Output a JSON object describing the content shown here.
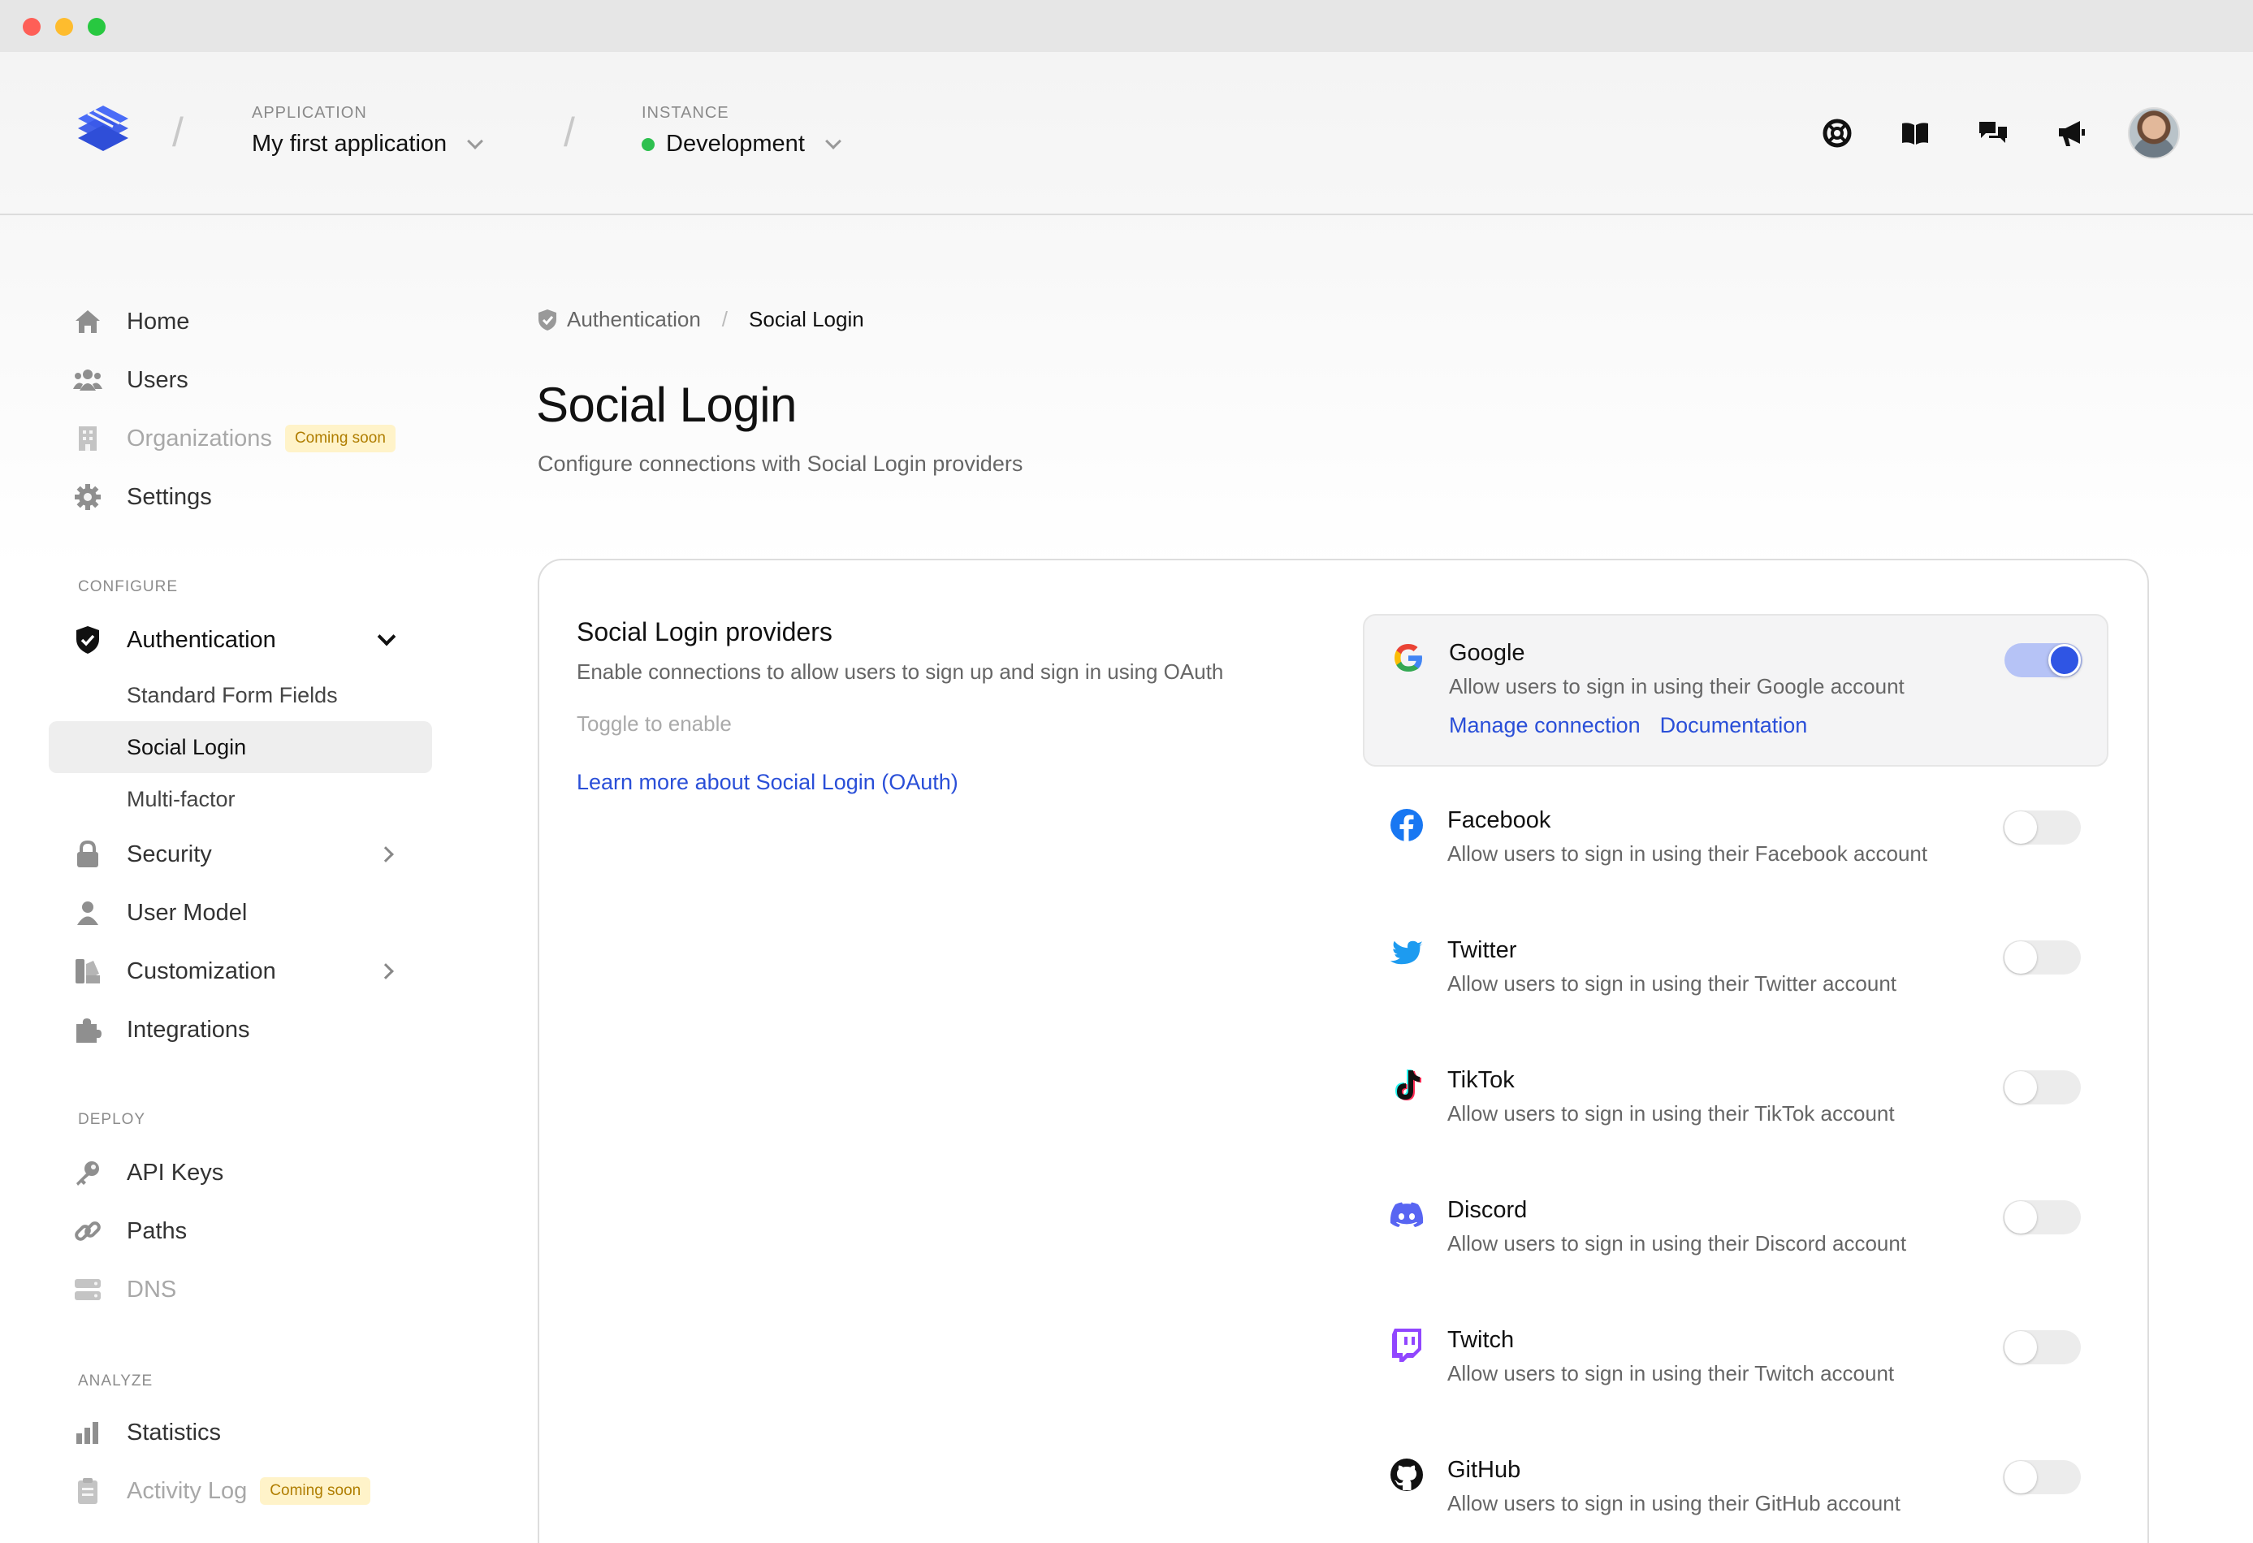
{
  "header": {
    "application_label": "APPLICATION",
    "application_value": "My first application",
    "instance_label": "INSTANCE",
    "instance_value": "Development",
    "instance_status_color": "#2ec04f",
    "icons": [
      "support-icon",
      "docs-book-icon",
      "chat-icon",
      "announcements-megaphone-icon"
    ]
  },
  "sidebar": {
    "main_items": [
      {
        "label": "Home",
        "icon": "home-icon"
      },
      {
        "label": "Users",
        "icon": "users-icon"
      },
      {
        "label": "Organizations",
        "icon": "building-icon",
        "badge": "Coming soon",
        "disabled": true
      },
      {
        "label": "Settings",
        "icon": "gear-icon"
      }
    ],
    "configure_label": "CONFIGURE",
    "configure_items": [
      {
        "label": "Authentication",
        "icon": "shield-icon",
        "expanded": true
      },
      {
        "label": "Standard Form Fields"
      },
      {
        "label": "Social Login",
        "active": true
      },
      {
        "label": "Multi-factor"
      },
      {
        "label": "Security",
        "icon": "lock-icon"
      },
      {
        "label": "User Model",
        "icon": "user-icon"
      },
      {
        "label": "Customization",
        "icon": "palette-icon"
      },
      {
        "label": "Integrations",
        "icon": "puzzle-icon"
      }
    ],
    "deploy_label": "DEPLOY",
    "deploy_items": [
      {
        "label": "API Keys",
        "icon": "key-icon"
      },
      {
        "label": "Paths",
        "icon": "link-icon"
      },
      {
        "label": "DNS",
        "icon": "server-icon",
        "disabled": true
      }
    ],
    "analyze_label": "ANALYZE",
    "analyze_items": [
      {
        "label": "Statistics",
        "icon": "bar-chart-icon"
      },
      {
        "label": "Activity Log",
        "icon": "clipboard-icon",
        "badge": "Coming soon",
        "disabled": true
      }
    ]
  },
  "breadcrumb": {
    "parent": "Authentication",
    "current": "Social Login"
  },
  "page": {
    "title": "Social Login",
    "subtitle": "Configure connections with Social Login providers"
  },
  "card": {
    "title": "Social Login providers",
    "description": "Enable connections to allow users to sign up and sign in using OAuth",
    "hint": "Toggle to enable",
    "learn_more": "Learn more about Social Login (OAuth)"
  },
  "providers": [
    {
      "name": "Google",
      "description": "Allow users to sign in using their Google account",
      "enabled": true,
      "manage": "Manage connection",
      "docs": "Documentation"
    },
    {
      "name": "Facebook",
      "description": "Allow users to sign in using their Facebook account",
      "enabled": false
    },
    {
      "name": "Twitter",
      "description": "Allow users to sign in using their Twitter account",
      "enabled": false
    },
    {
      "name": "TikTok",
      "description": "Allow users to sign in using their TikTok account",
      "enabled": false
    },
    {
      "name": "Discord",
      "description": "Allow users to sign in using their Discord account",
      "enabled": false
    },
    {
      "name": "Twitch",
      "description": "Allow users to sign in using their Twitch account",
      "enabled": false
    },
    {
      "name": "GitHub",
      "description": "Allow users to sign in using their GitHub account",
      "enabled": false
    }
  ],
  "colors": {
    "accent": "#2f55e4",
    "link": "#2a4fd8",
    "badge_bg": "#fff3c9",
    "badge_text": "#b07d00"
  }
}
